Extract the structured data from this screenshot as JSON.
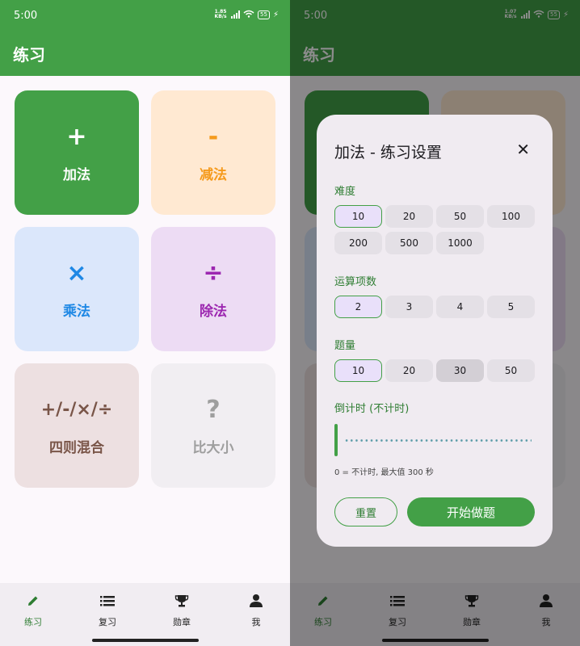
{
  "status": {
    "time": "5:00",
    "net_speed_left": "1.85 KB/s",
    "net_speed_right": "1.07 KB/s",
    "battery": "55"
  },
  "appbar": {
    "title": "练习"
  },
  "cards": [
    {
      "symbol": "+",
      "label": "加法",
      "bg": "#43a047",
      "color": "#ffffff"
    },
    {
      "symbol": "-",
      "label": "减法",
      "bg": "#ffe9d2",
      "color": "#f59a1c"
    },
    {
      "symbol": "×",
      "label": "乘法",
      "bg": "#dbe7fb",
      "color": "#1e88e5"
    },
    {
      "symbol": "÷",
      "label": "除法",
      "bg": "#eddcf4",
      "color": "#9c27b0"
    },
    {
      "symbol": "+/-/×/÷",
      "label": "四则混合",
      "bg": "#ede0e1",
      "color": "#795548"
    },
    {
      "symbol": "?",
      "label": "比大小",
      "bg": "#f1eef2",
      "color": "#9e9e9e"
    }
  ],
  "nav": [
    {
      "label": "练习",
      "icon": "pencil-icon",
      "active": true
    },
    {
      "label": "复习",
      "icon": "list-icon",
      "active": false
    },
    {
      "label": "勋章",
      "icon": "trophy-icon",
      "active": false
    },
    {
      "label": "我",
      "icon": "person-icon",
      "active": false
    }
  ],
  "dialog": {
    "title": "加法 - 练习设置",
    "difficulty": {
      "label": "难度",
      "options": [
        "10",
        "20",
        "50",
        "100",
        "200",
        "500",
        "1000"
      ],
      "selected": "10"
    },
    "terms": {
      "label": "运算项数",
      "options": [
        "2",
        "3",
        "4",
        "5"
      ],
      "selected": "2"
    },
    "count": {
      "label": "题量",
      "options": [
        "10",
        "20",
        "30",
        "50"
      ],
      "selected": "10"
    },
    "timer": {
      "label": "倒计时 (不计时)",
      "hint": "0 = 不计时, 最大值 300 秒",
      "value": 0,
      "max": 300
    },
    "reset_label": "重置",
    "start_label": "开始做题"
  },
  "colors": {
    "primary": "#43a047",
    "primary_dark": "#2e7d32"
  }
}
